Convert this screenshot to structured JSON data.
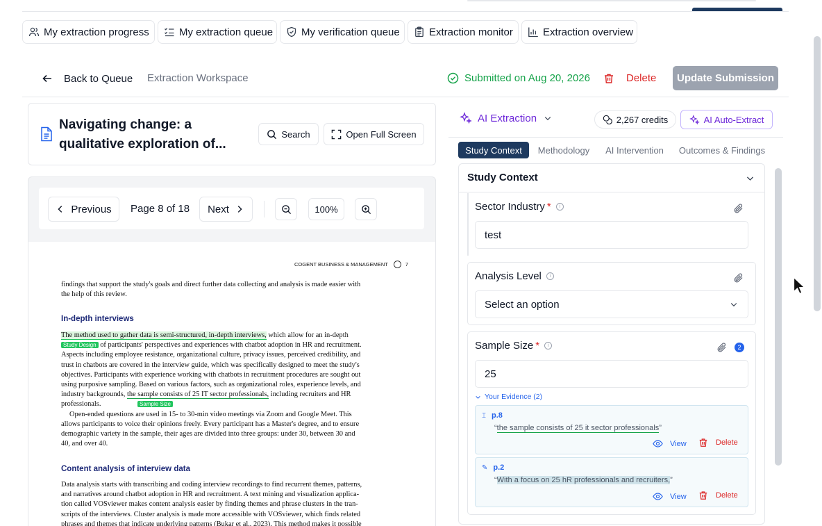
{
  "nav": {
    "items": [
      {
        "label": "My extraction progress",
        "icon": "users-icon"
      },
      {
        "label": "My extraction queue",
        "icon": "list-checks-icon"
      },
      {
        "label": "My verification queue",
        "icon": "shield-check-icon"
      },
      {
        "label": "Extraction monitor",
        "icon": "clipboard-icon"
      },
      {
        "label": "Extraction overview",
        "icon": "bar-chart-icon"
      }
    ]
  },
  "header": {
    "back_label": "Back to Queue",
    "workspace_label": "Extraction Workspace",
    "submitted": "Submitted on Aug 20, 2026",
    "delete_label": "Delete",
    "update_label": "Update Submission"
  },
  "doc": {
    "title": "Navigating change: a qualitative exploration of...",
    "search_label": "Search",
    "fullscreen_label": "Open Full Screen"
  },
  "pager": {
    "prev_label": "Previous",
    "page_text": "Page 8 of 18",
    "next_label": "Next",
    "zoom": "100%"
  },
  "pdf": {
    "running_head": "COGENT BUSINESS & MANAGEMENT",
    "page_num": "7",
    "intro_l1": "findings that support the study's goals and direct further data collecting and analysis is made easier with",
    "intro_l2": "the help of this review.",
    "h1": "In-depth interviews",
    "hl1": "The method used to gather data is semi-structured, in-depth interviews,",
    "p1a": " which allow for an in-depth",
    "tag1": "Study Design",
    "p1b": " of participants' perspectives and experiences with chatbot adoption in HR and recruitment.",
    "p1c": "Aspects including employee resistance, organizational culture, privacy issues, perceived credibility, and",
    "p1d": "trust in chatbots are covered in the interview guide, which was specifically designed to meet the study's",
    "p1e": "objectives. Participants with experience working with chatbots in recruitment procedures are sought out",
    "p1f": "using purposive sampling. Based on various factors, such as organizational roles, experience levels, and",
    "p1g_a": "industry backgrounds, ",
    "hl2": "the sample consists of 25 IT sector professionals,",
    "p1g_b": " including recruiters and HR",
    "p1h": "professionals.",
    "tag2": "Sample Size",
    "p2a": "Open-ended questions are used in 15- to 30-min video meetings via Zoom and Google Meet. This",
    "p2b": "allows participants to voice their opinions freely. Every participant has a Master's degree, and to ensure",
    "p2c": "demographic variety in the sample, their ages are divided into three groups: under 30, between 30 and",
    "p2d": "40, and over 40.",
    "h2": "Content analysis of interview data",
    "p3a": "Data analysis starts with transcribing and coding interview recordings to find recurrent themes, patterns,",
    "p3b": "and narratives around chatbot adoption in HR and recruitment. A text mining and visualization applica-",
    "p3c": "tion called VOSviewer makes content analysis easier by finding themes and phrase clusters in the tran-",
    "p3d": "scripts of the interviews. Cluster analysis is made more accessible with VOSviewer, which finds related",
    "p3e": "phrases and themes that indicate underlying patterns (Bukar et al., 2023). This method makes it possible"
  },
  "right": {
    "ai_label": "AI Extraction",
    "credits": "2,267 credits",
    "auto_label": "AI Auto-Extract",
    "tabs": [
      "Study Context",
      "Methodology",
      "AI Intervention",
      "Outcomes & Findings"
    ],
    "section_title": "Study Context",
    "fields": {
      "sector": {
        "label": "Sector Industry",
        "value": "test"
      },
      "analysis": {
        "label": "Analysis Level",
        "placeholder": "Select an option"
      },
      "sample": {
        "label": "Sample Size",
        "value": "25",
        "badge": "2"
      }
    },
    "evidence_toggle": "Your Evidence (2)",
    "evidence": [
      {
        "page": "p.8",
        "quote": "the sample consists of 25 it sector professionals",
        "view": "View",
        "delete": "Delete"
      },
      {
        "page": "p.2",
        "quote": "With a focus on 25 hR professionals and recruiters,",
        "view": "View",
        "delete": "Delete"
      }
    ]
  },
  "colors": {
    "accent_purple": "#6d28d9",
    "tab_active": "#1e3a5f",
    "success": "#16a34a",
    "danger": "#dc2626"
  }
}
